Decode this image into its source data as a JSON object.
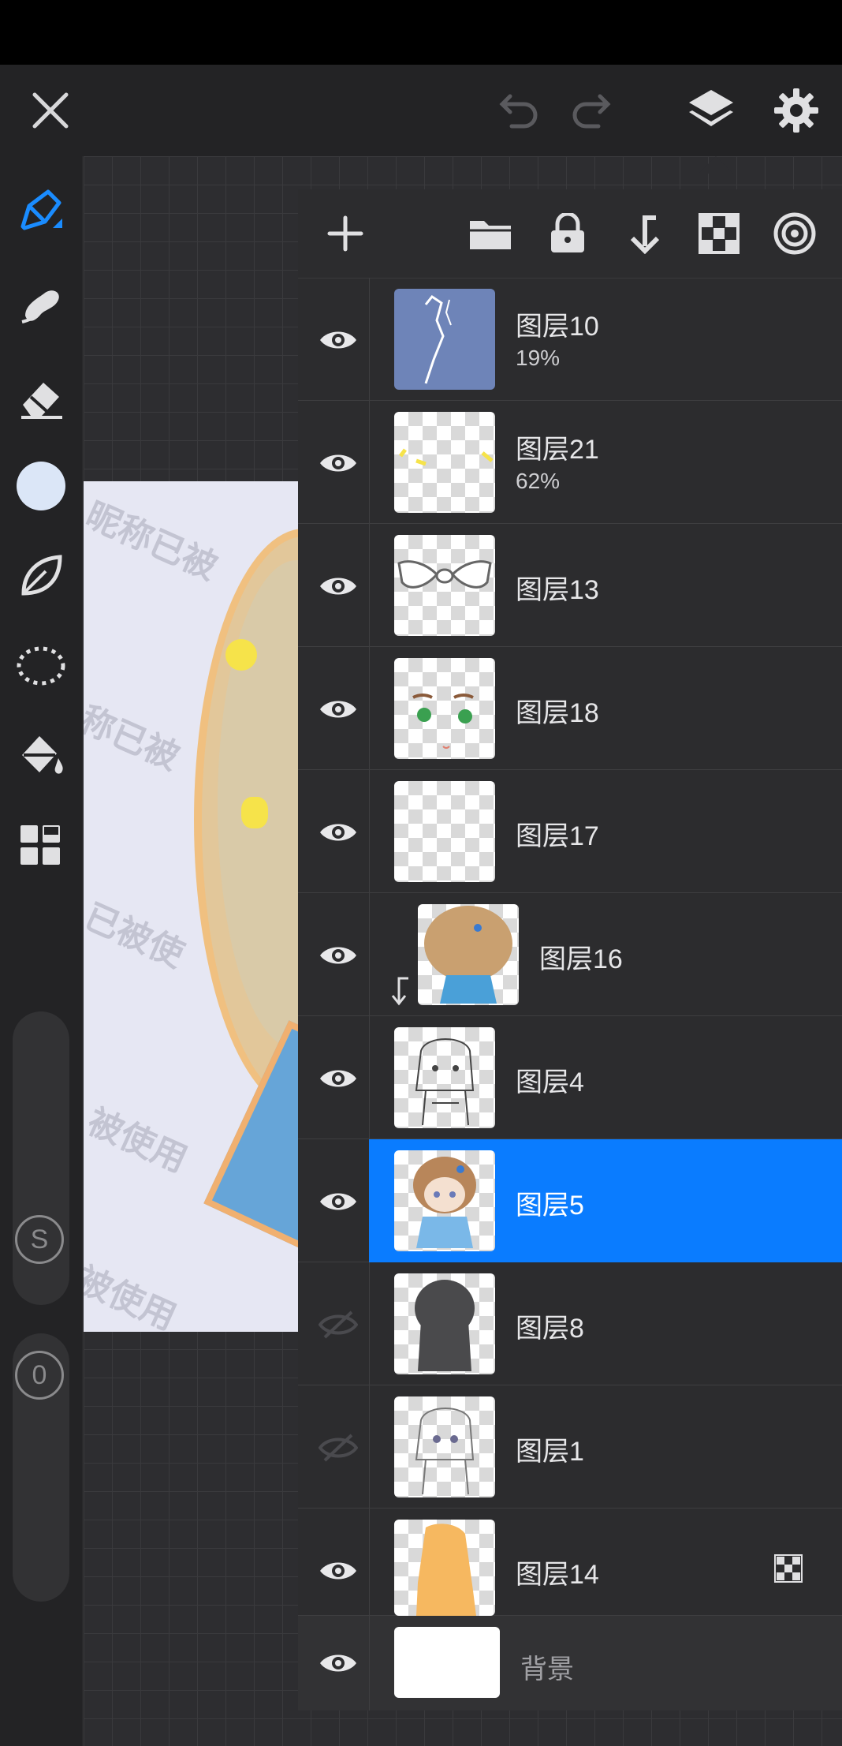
{
  "colors": {
    "accent": "#0a7cff",
    "panel_bg": "#2c2c2e",
    "toolbar_bg": "#232325",
    "brush_color": "#dbe6f7"
  },
  "topbar": {
    "close_icon": "close-icon",
    "undo_icon": "undo-icon",
    "redo_icon": "redo-icon",
    "layers_icon": "layers-icon",
    "settings_icon": "gear-icon"
  },
  "toolbar": {
    "tools": [
      "pen-icon",
      "smudge-icon",
      "eraser-icon",
      "color-swatch",
      "leaf-icon",
      "lasso-icon",
      "bucket-icon",
      "grid-icon"
    ],
    "size_label": "S",
    "opacity_label": "0"
  },
  "artboard": {
    "watermark": [
      "昵称已被",
      "称已被",
      "已被使",
      "被使用",
      "被使用"
    ]
  },
  "layer_panel": {
    "actions": [
      "add-icon",
      "folder-icon",
      "lock-icon",
      "merge-down-icon",
      "alpha-lock-icon",
      "reference-icon"
    ],
    "layers": [
      {
        "name": "图层10",
        "opacity": "19%",
        "visible": true
      },
      {
        "name": "图层21",
        "opacity": "62%",
        "visible": true
      },
      {
        "name": "图层13",
        "visible": true
      },
      {
        "name": "图层18",
        "visible": true
      },
      {
        "name": "图层17",
        "visible": true
      },
      {
        "name": "图层16",
        "visible": true,
        "clipped": true
      },
      {
        "name": "图层4",
        "visible": true
      },
      {
        "name": "图层5",
        "visible": true,
        "selected": true
      },
      {
        "name": "图层8",
        "visible": false
      },
      {
        "name": "图层1",
        "visible": false
      },
      {
        "name": "图层14",
        "visible": true,
        "alpha_locked": true
      }
    ],
    "background": {
      "name": "背景",
      "visible": true
    }
  }
}
